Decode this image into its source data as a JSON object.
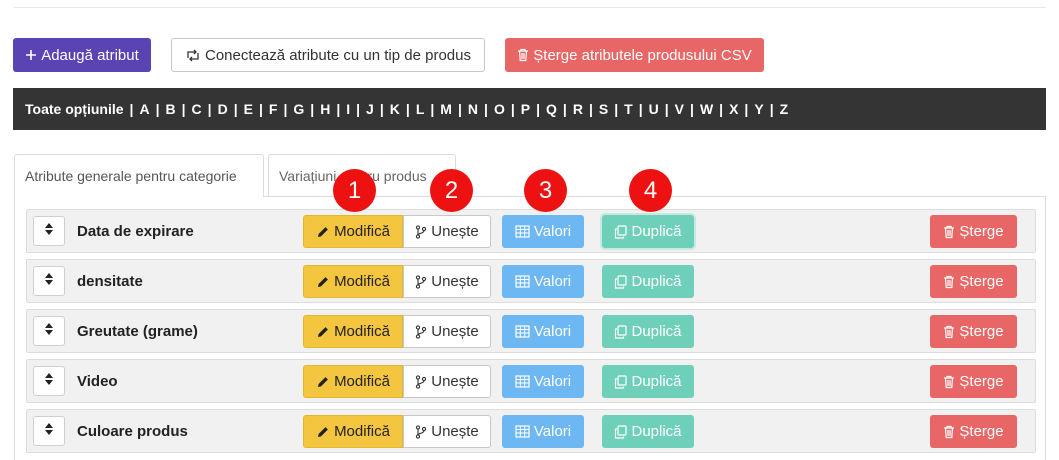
{
  "toolbar": {
    "add_label": "Adaugă atribut",
    "connect_label": "Conectează atribute cu un tip de produs",
    "delete_csv_label": "Șterge atributele produsului CSV"
  },
  "alphabet": {
    "all_label": "Toate opțiunile",
    "letters": [
      "A",
      "B",
      "C",
      "D",
      "E",
      "F",
      "G",
      "H",
      "I",
      "J",
      "K",
      "L",
      "M",
      "N",
      "O",
      "P",
      "Q",
      "R",
      "S",
      "T",
      "U",
      "V",
      "W",
      "X",
      "Y",
      "Z"
    ]
  },
  "tabs": [
    {
      "label": "Atribute generale pentru categorie",
      "active": true
    },
    {
      "label": "Variațiuni pentru produs",
      "active": false
    }
  ],
  "row_actions": {
    "edit": "Modifică",
    "merge": "Unește",
    "values": "Valori",
    "duplicate": "Duplică",
    "delete": "Șterge"
  },
  "rows": [
    {
      "name": "Data de expirare"
    },
    {
      "name": "densitate"
    },
    {
      "name": "Greutate (grame)"
    },
    {
      "name": "Video"
    },
    {
      "name": "Culoare produs"
    }
  ],
  "markers": [
    "1",
    "2",
    "3",
    "4"
  ],
  "colors": {
    "primary": "#5a43b3",
    "danger": "#e96666",
    "warning": "#f4c53f",
    "info": "#6db8f2",
    "success": "#6ed0b9",
    "bar": "#343434",
    "marker": "#ee1111"
  }
}
